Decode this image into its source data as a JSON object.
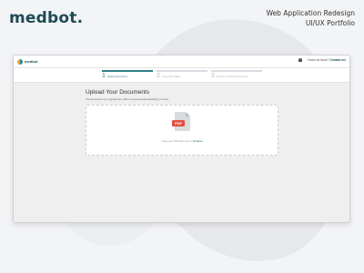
{
  "brand": "medbot.",
  "portfolio": {
    "line1": "Web Application Redesign",
    "line2": "UI/UX Portfolio"
  },
  "app": {
    "logo_text": "medbot",
    "help_text": "Faced an issue?",
    "contact_label": "Contact us!"
  },
  "steps": [
    {
      "num": "1",
      "label": "Upload Documents",
      "active": true
    },
    {
      "num": "2",
      "label": "Verify Information",
      "active": false
    },
    {
      "num": "3",
      "label": "Confirm & Submit Documents",
      "active": false
    }
  ],
  "upload": {
    "title": "Upload Your Documents",
    "subtitle": "The documents you upload here will be reviewed automatically by our bot.",
    "file_tag": "PDF",
    "drop_text": "Drag your PDF files here or",
    "browse_label": "browse"
  },
  "colors": {
    "accent": "#2f7f87",
    "brand": "#1f4a55",
    "pdf_red": "#e4503e"
  }
}
